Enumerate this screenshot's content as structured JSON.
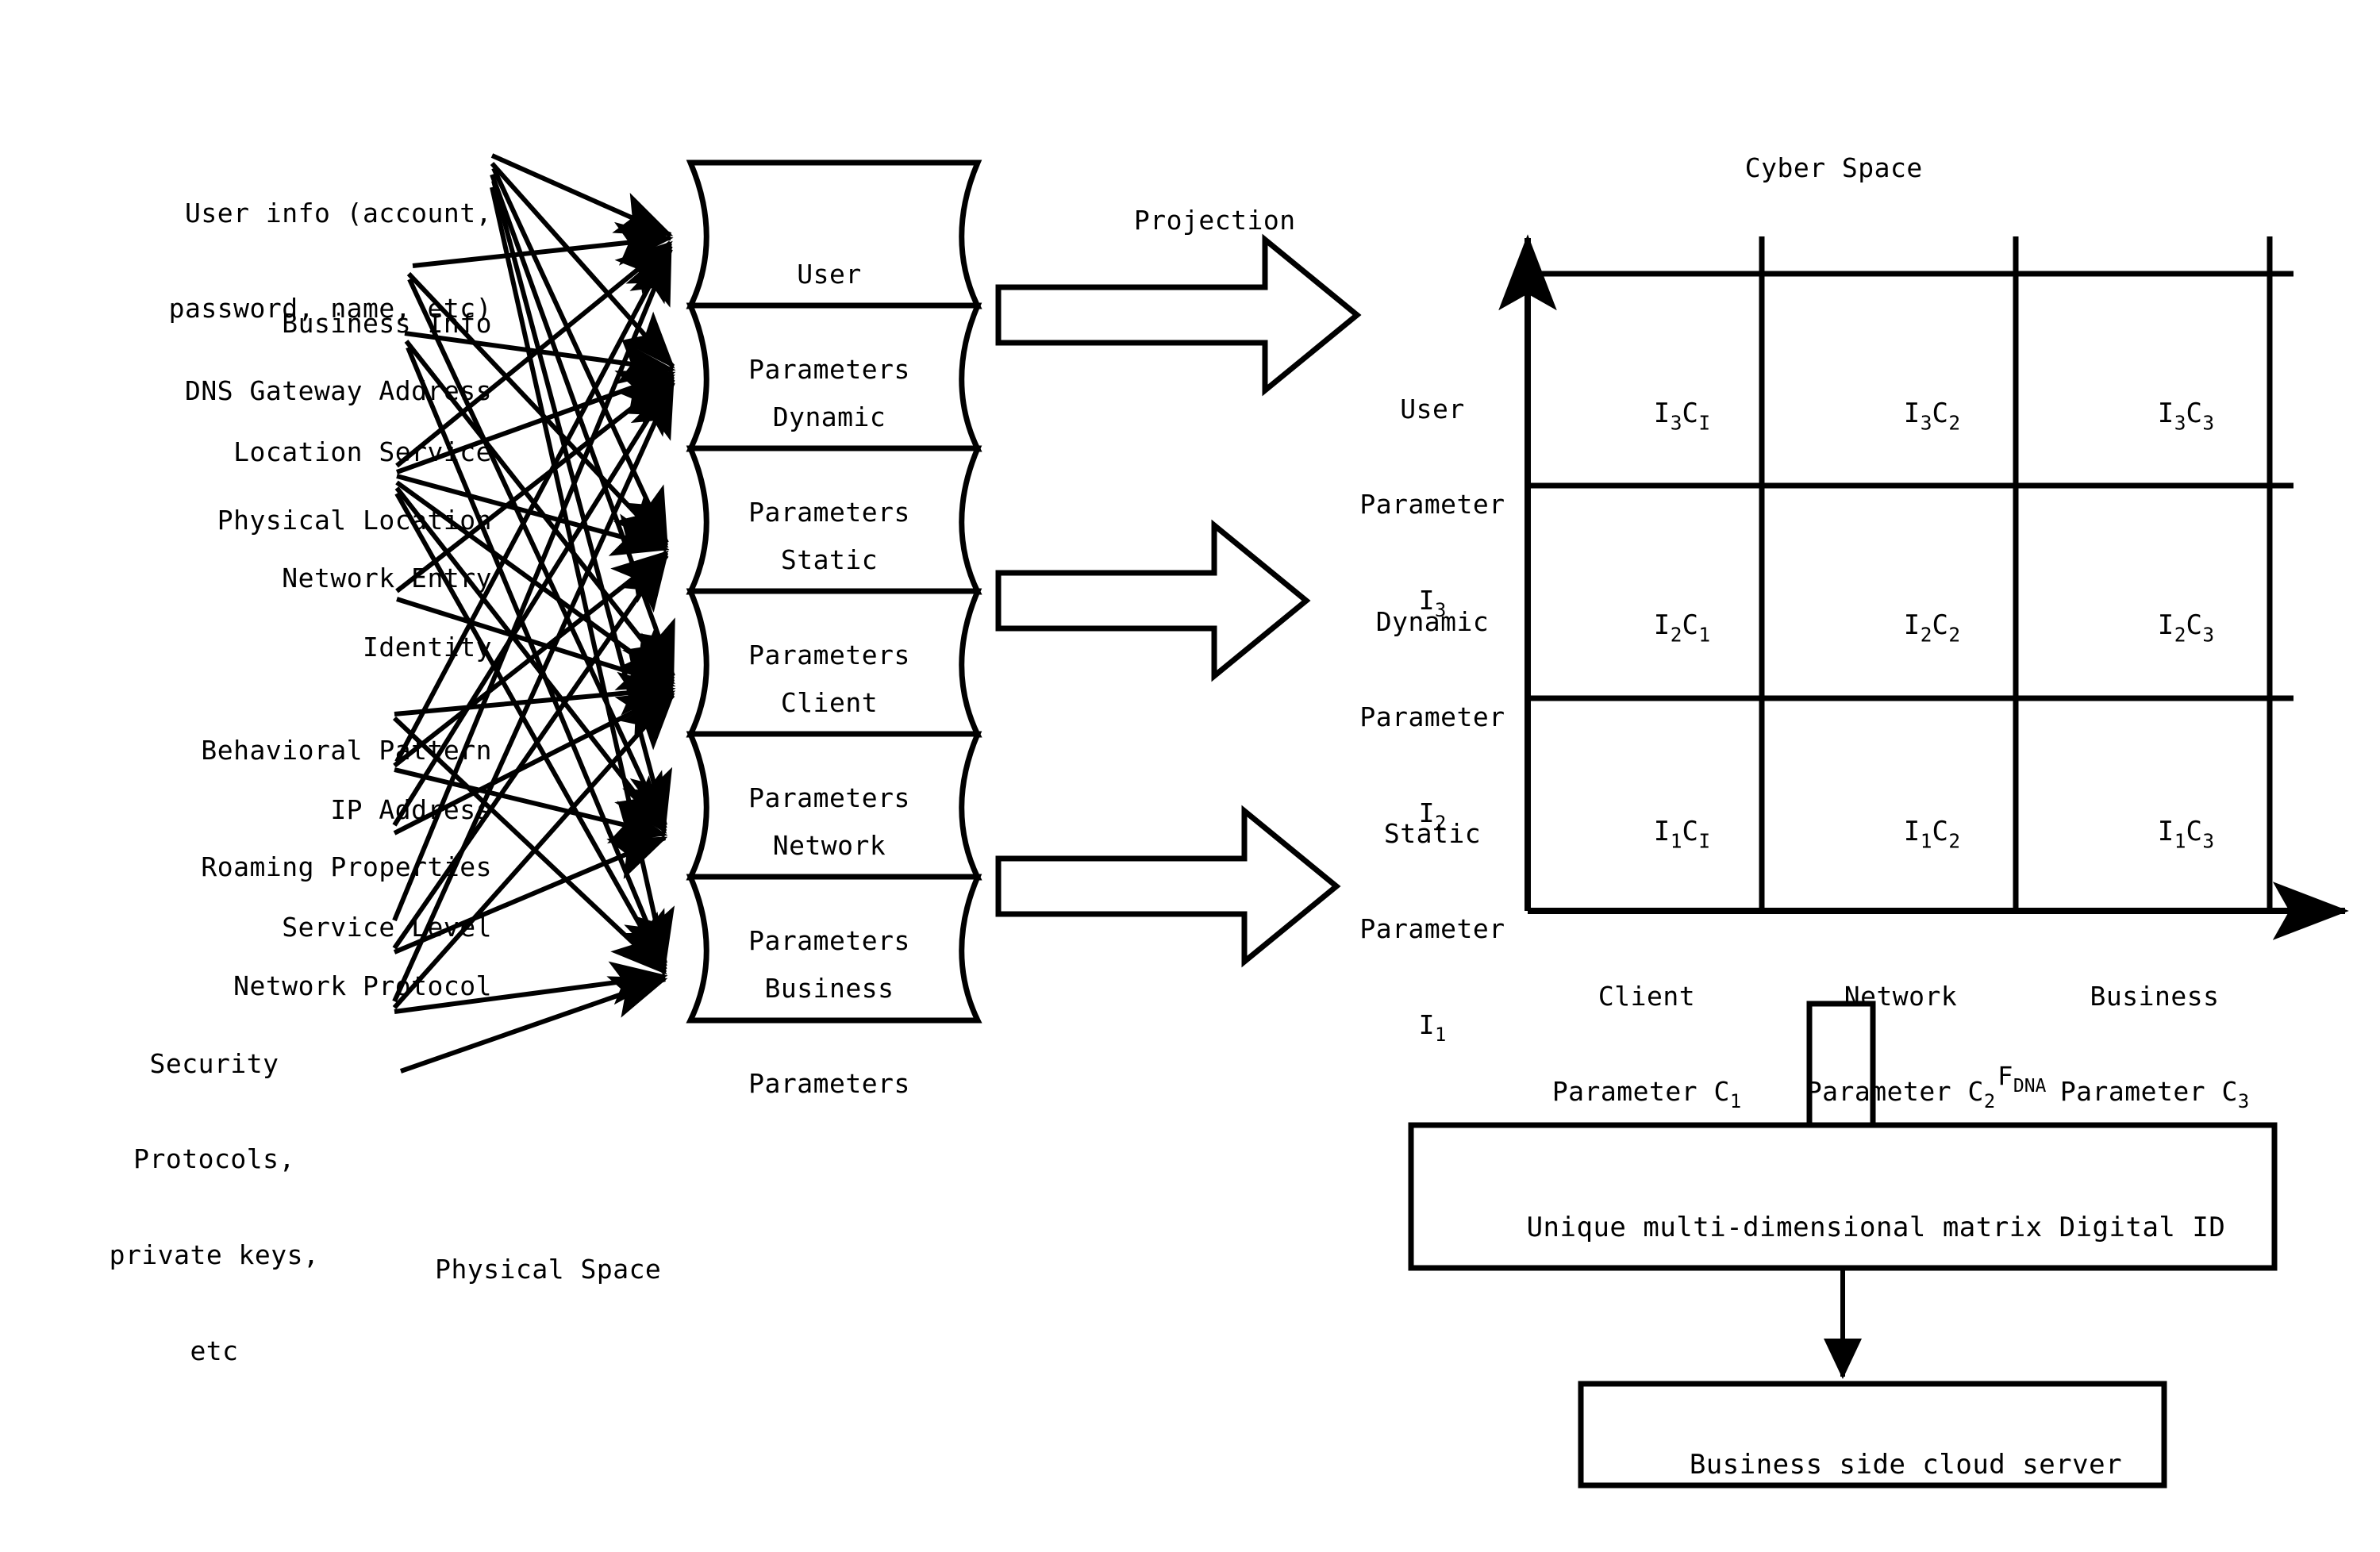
{
  "figure": {
    "physical_space_title": "Physical Space",
    "cyber_space_title": "Cyber Space",
    "projection_label": "Projection",
    "fdna_label_main": "F",
    "fdna_label_sub": "DNA"
  },
  "sources": [
    {
      "id": "user-info",
      "lines": [
        "User info (account,",
        "password, name, etc)"
      ]
    },
    {
      "id": "business-info",
      "lines": [
        "Business Info"
      ]
    },
    {
      "id": "dns-gateway-address",
      "lines": [
        "DNS Gateway Address"
      ]
    },
    {
      "id": "location-service",
      "lines": [
        "Location Service"
      ]
    },
    {
      "id": "physical-location",
      "lines": [
        "Physical Location"
      ]
    },
    {
      "id": "network-entry",
      "lines": [
        "Network Entry"
      ]
    },
    {
      "id": "identity",
      "lines": [
        "Identity"
      ]
    },
    {
      "id": "behavioral-pattern",
      "lines": [
        "Behavioral Pattern"
      ]
    },
    {
      "id": "ip-address",
      "lines": [
        "IP Address"
      ]
    },
    {
      "id": "roaming-properties",
      "lines": [
        "Roaming Properties"
      ]
    },
    {
      "id": "service-level",
      "lines": [
        "Service Level"
      ]
    },
    {
      "id": "network-protocol",
      "lines": [
        "Network Protocol"
      ]
    },
    {
      "id": "security-protocols",
      "lines": [
        "Security",
        "Protocols,",
        "private keys,",
        "etc"
      ]
    }
  ],
  "parameter_boxes": [
    {
      "id": "user-parameters",
      "line1": "User",
      "line2": "Parameters"
    },
    {
      "id": "dynamic-parameters",
      "line1": "Dynamic",
      "line2": "Parameters"
    },
    {
      "id": "static-parameters",
      "line1": "Static",
      "line2": "Parameters"
    },
    {
      "id": "client-parameters",
      "line1": "Client",
      "line2": "Parameters"
    },
    {
      "id": "network-parameters",
      "line1": "Network",
      "line2": "Parameters"
    },
    {
      "id": "business-parameters",
      "line1": "Business",
      "line2": "Parameters"
    }
  ],
  "chart_data": {
    "type": "heatmap",
    "title": "Cyber Space",
    "xlabel": "",
    "ylabel": "",
    "grid": true,
    "legend": "none",
    "row_axis_labels": [
      {
        "line1": "User",
        "line2": "Parameter",
        "symbol": "I",
        "sub": "3"
      },
      {
        "line1": "Dynamic",
        "line2": "Parameter",
        "symbol": "I",
        "sub": "2"
      },
      {
        "line1": "Static",
        "line2": "Parameter",
        "symbol": "I",
        "sub": "1"
      }
    ],
    "column_axis_labels": [
      {
        "line1": "Client",
        "line2": "Parameter C",
        "sub": "1"
      },
      {
        "line1": "Network",
        "line2": "Parameter C",
        "sub": "2"
      },
      {
        "line1": "Business",
        "line2": "Parameter C",
        "sub": "3"
      }
    ],
    "rows": [
      "I3",
      "I2",
      "I1"
    ],
    "columns": [
      "C1",
      "C2",
      "C3"
    ],
    "cells": [
      [
        {
          "a": "I",
          "asub": "3",
          "b": "C",
          "bsub": "I"
        },
        {
          "a": "I",
          "asub": "3",
          "b": "C",
          "bsub": "2"
        },
        {
          "a": "I",
          "asub": "3",
          "b": "C",
          "bsub": "3"
        }
      ],
      [
        {
          "a": "I",
          "asub": "2",
          "b": "C",
          "bsub": "1"
        },
        {
          "a": "I",
          "asub": "2",
          "b": "C",
          "bsub": "2"
        },
        {
          "a": "I",
          "asub": "2",
          "b": "C",
          "bsub": "3"
        }
      ],
      [
        {
          "a": "I",
          "asub": "1",
          "b": "C",
          "bsub": "I"
        },
        {
          "a": "I",
          "asub": "1",
          "b": "C",
          "bsub": "2"
        },
        {
          "a": "I",
          "asub": "1",
          "b": "C",
          "bsub": "3"
        }
      ]
    ]
  },
  "output_boxes": [
    {
      "id": "digital-id",
      "label": "Unique multi-dimensional matrix Digital ID"
    },
    {
      "id": "business-cloud-server",
      "label": "Business side cloud server"
    }
  ],
  "colors": {
    "stroke": "#000000",
    "background": "#ffffff"
  }
}
